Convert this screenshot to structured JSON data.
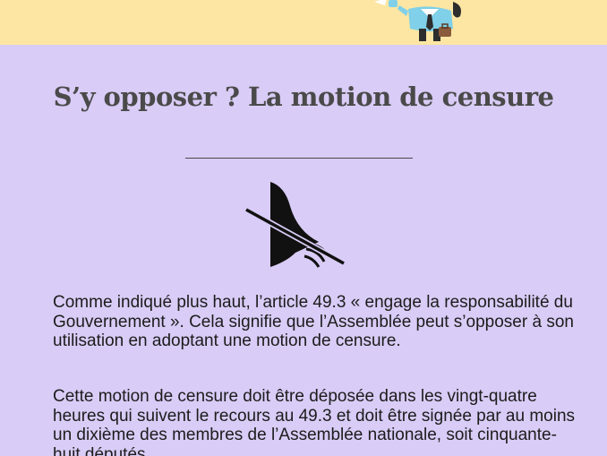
{
  "header": {
    "title": "S’y opposer ? La motion de censure"
  },
  "content": {
    "paragraphs": [
      "Comme indiqué plus haut, l’article 49.3 « engage la responsabilité du Gouvernement ». Cela signifie que l’Assemblée peut s’opposer à son utilisation en adoptant une motion de censure.",
      "Cette motion de censure doit être déposée dans les vingt-quatre heures qui suivent le recours au 49.3 et doit être signée par au moins un dixième des membres de l’Assemblée nationale, soit cinquante-huit députés."
    ]
  },
  "icons": {
    "illustration": "businessman-illustration",
    "section_icon": "gavel-crossed-icon"
  },
  "colors": {
    "background": "#d9ccf6",
    "top_band": "#fde6a3",
    "title": "#4a4a4a",
    "text": "#1c1c1c"
  }
}
